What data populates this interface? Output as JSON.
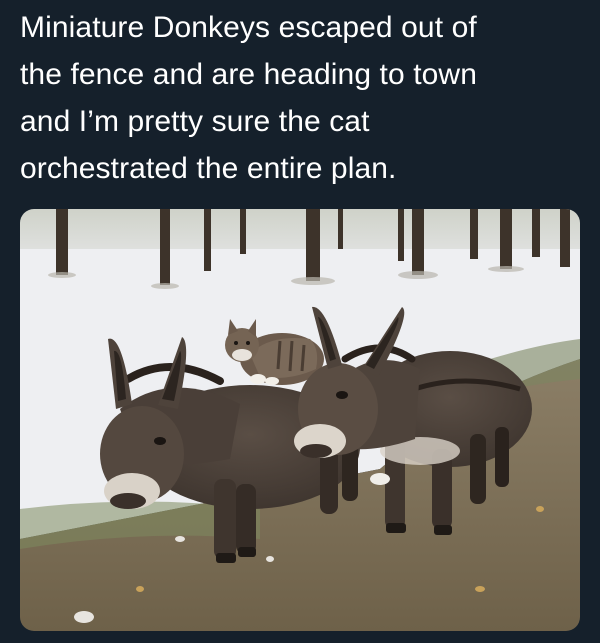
{
  "post": {
    "text_lines": [
      "Miniature Donkeys escaped out of",
      "the fence and are heading to town",
      "and I’m pretty sure the cat",
      "orchestrated the entire plan."
    ]
  },
  "media": {
    "subjects": [
      "donkey",
      "donkey",
      "cat"
    ],
    "colors": {
      "background": "#15202b",
      "text": "#ffffff",
      "snow": "#eeeff2",
      "ground": "#8b7a62",
      "donkey": "#4a3f38",
      "cat": "#6b5a4c"
    }
  }
}
